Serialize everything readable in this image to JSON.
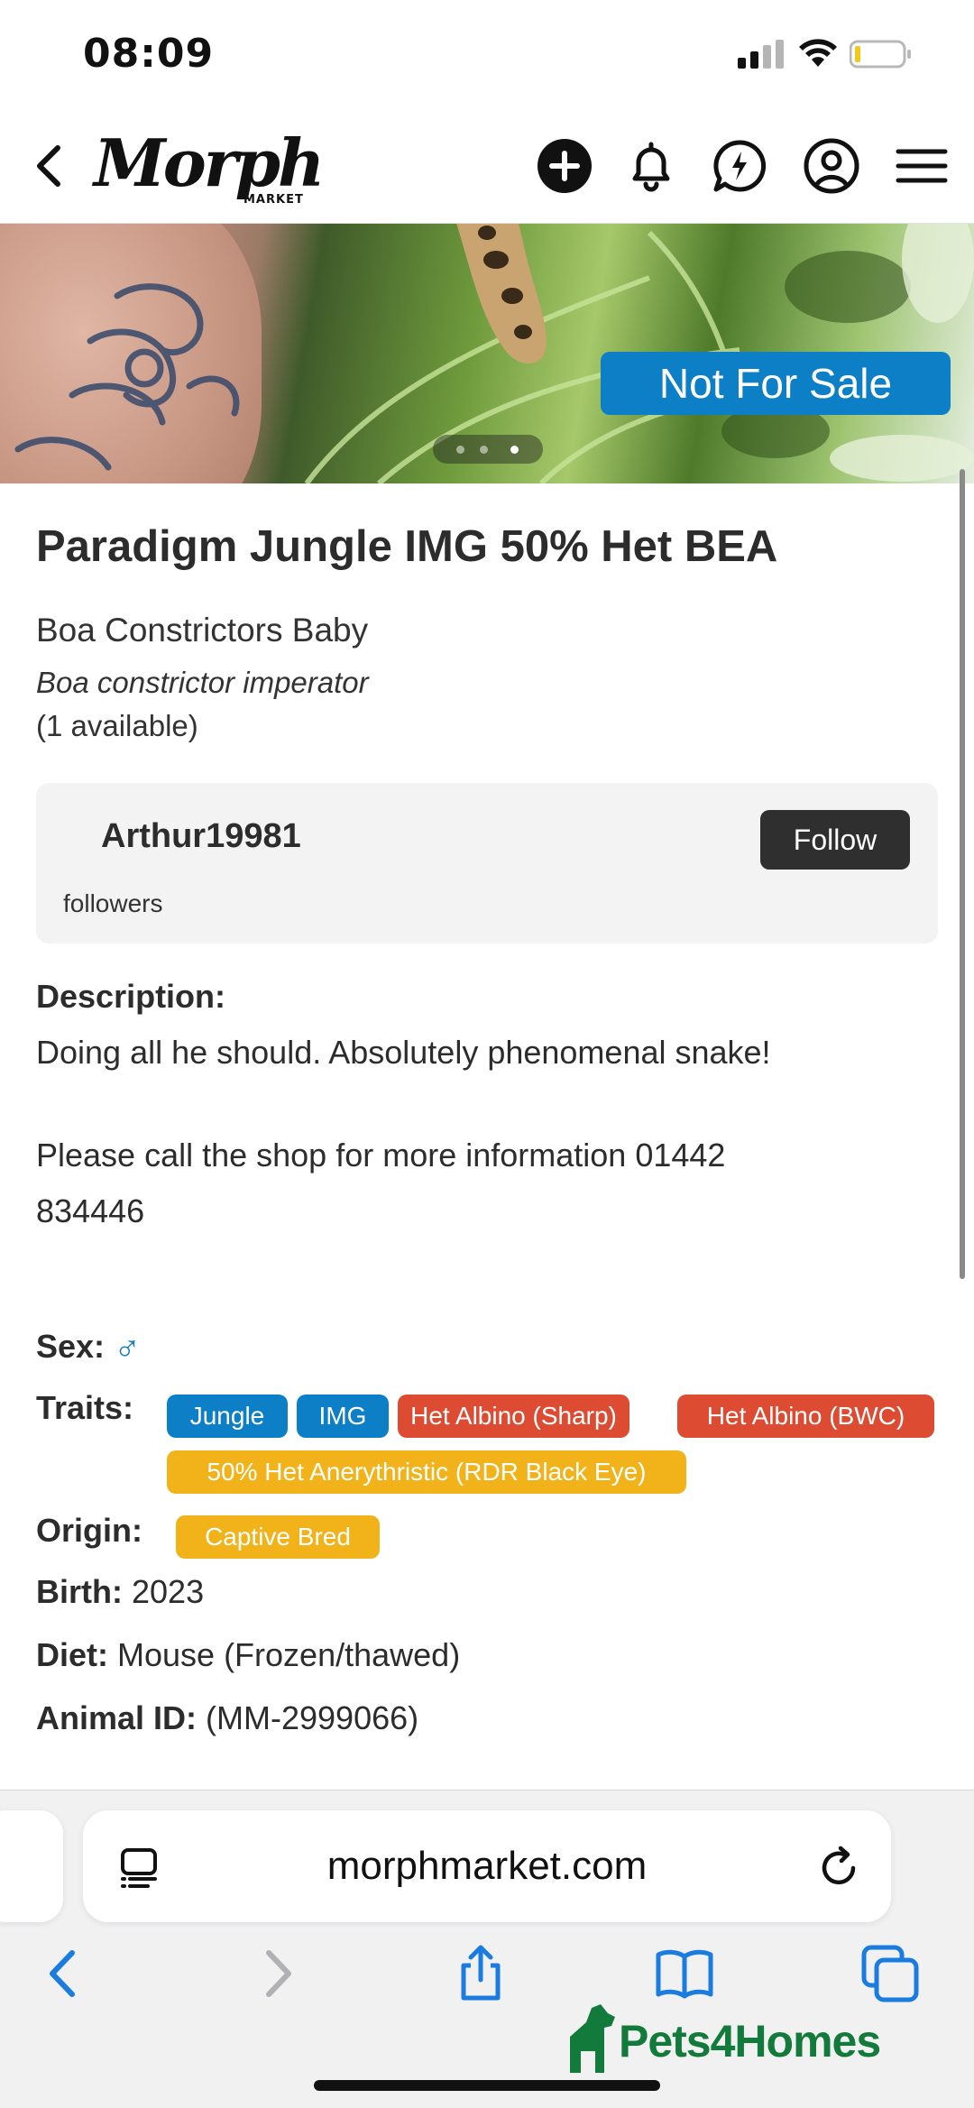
{
  "status_bar": {
    "time": "08:09"
  },
  "header": {
    "logo_text": "Morph",
    "logo_subtext": "MARKET"
  },
  "hero": {
    "badge": "Not For Sale",
    "image_count": 3,
    "active_image": 3
  },
  "listing": {
    "title": "Paradigm Jungle IMG 50% Het BEA",
    "category": "Boa Constrictors Baby",
    "scientific_name": "Boa constrictor imperator",
    "availability": "(1 available)"
  },
  "seller": {
    "name": "Arthur19981",
    "followers_label": "followers",
    "follow_label": "Follow"
  },
  "description": {
    "label": "Description:",
    "line1": "Doing all he should. Absolutely phenomenal snake!",
    "line2": "Please call the shop for more information 01442",
    "line3": "834446"
  },
  "attributes": {
    "sex_label": "Sex:",
    "sex_symbol": "♂",
    "traits_label": "Traits:",
    "traits": [
      {
        "label": "Jungle",
        "color": "#0d7fc7"
      },
      {
        "label": "IMG",
        "color": "#0d7fc7"
      },
      {
        "label": "Het Albino (Sharp)",
        "color": "#dc4b32"
      },
      {
        "label": "Het Albino (BWC)",
        "color": "#dc4b32"
      },
      {
        "label": "50% Het Anerythristic (RDR Black Eye)",
        "color": "#f2b21a"
      }
    ],
    "origin_label": "Origin:",
    "origin_value": "Captive Bred",
    "birth_label": "Birth:",
    "birth_value": "2023",
    "diet_label": "Diet:",
    "diet_value": "Mouse (Frozen/thawed)",
    "animal_id_label": "Animal ID:",
    "animal_id_value": "(MM-2999066)"
  },
  "browser": {
    "url": "morphmarket.com"
  },
  "watermark": {
    "text": "Pets4Homes"
  }
}
